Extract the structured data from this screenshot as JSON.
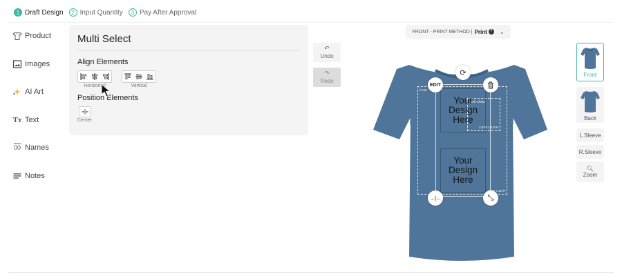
{
  "steps": [
    {
      "num": "1",
      "label": "Draft Design"
    },
    {
      "num": "2",
      "label": "Input Quantity"
    },
    {
      "num": "3",
      "label": "Pay After Approval"
    }
  ],
  "nav": {
    "items": [
      {
        "label": "Product",
        "icon": "shirt-outline-icon"
      },
      {
        "label": "Images",
        "icon": "image-icon"
      },
      {
        "label": "AI Art",
        "icon": "sparkle-icon"
      },
      {
        "label": "Text",
        "icon": "text-icon"
      },
      {
        "label": "Names",
        "icon": "names-icon"
      },
      {
        "label": "Notes",
        "icon": "lines-icon"
      }
    ]
  },
  "panel": {
    "title": "Multi Select",
    "align_label": "Align Elements",
    "horizontal_caption": "Horizontal",
    "vertical_caption": "Vertical",
    "position_label": "Position Elements",
    "center_caption": "Center"
  },
  "history": {
    "undo": "Undo",
    "redo": "Redo"
  },
  "print_selector": {
    "prefix": "FRONT - PRINT METHOD  |",
    "value": "Print"
  },
  "canvas": {
    "shirt_color": "#50759a",
    "area_label": "Front",
    "area_size": "12\"W x 12\"H",
    "left_chest_label": "Left Chest",
    "left_chest_size": "3.5\"W x 3.5\"H",
    "design_1_text": "Your Design Here",
    "design_2_text": "Your Design Here",
    "edit_label": "EDIT"
  },
  "views": {
    "front": "Front",
    "back": "Back",
    "left_sleeve": "L.Sleeve",
    "right_sleeve": "R.Sleeve",
    "zoom": "Zoom"
  },
  "colors": {
    "accent": "#3cb8a4",
    "panel_bg": "#f3f4f3"
  }
}
